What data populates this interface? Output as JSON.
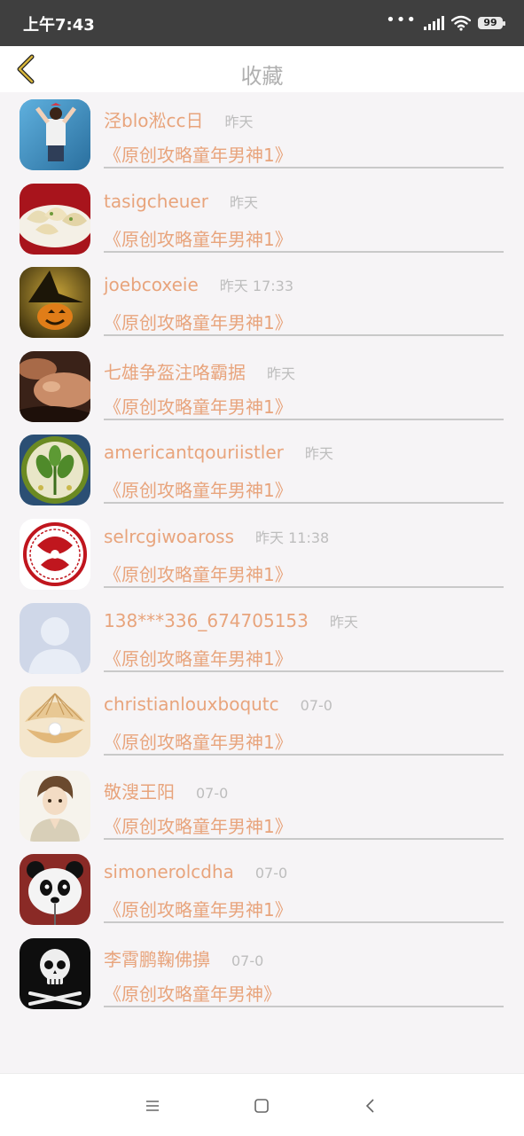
{
  "status_bar": {
    "time": "上午7:43",
    "dots": "•••",
    "battery": "99"
  },
  "header": {
    "title": "收藏",
    "back_icon": "chevron-left-icon"
  },
  "items": [
    {
      "name": "泾blo淞cc日",
      "time": "昨天",
      "title": "《原创攻略童年男神1》",
      "avatar": "photo-girl-wall"
    },
    {
      "name": "tasigcheuer",
      "time": "昨天",
      "title": "《原创攻略童年男神1》",
      "avatar": "photo-dumplings"
    },
    {
      "name": "joebcoxeie",
      "time": "昨天 17:33",
      "title": "《原创攻略童年男神1》",
      "avatar": "photo-halloween-pumpkin"
    },
    {
      "name": "七雄争盔注咯霸据",
      "time": "昨天",
      "title": "《原创攻略童年男神1》",
      "avatar": "photo-massage"
    },
    {
      "name": "americantqouriistler",
      "time": "昨天",
      "title": "《原创攻略童年男神1》",
      "avatar": "photo-leaf-plate"
    },
    {
      "name": "selrcgiwoaross",
      "time": "昨天 11:38",
      "title": "《原创攻略童年男神1》",
      "avatar": "photo-papercut"
    },
    {
      "name": "138***336_674705153",
      "time": "昨天",
      "title": "《原创攻略童年男神1》",
      "avatar": "default-avatar"
    },
    {
      "name": "christianlouxboqutc",
      "time": "07-0",
      "title": "《原创攻略童年男神1》",
      "avatar": "photo-shell-pearl"
    },
    {
      "name": "敬溲王阳",
      "time": "07-0",
      "title": "《原创攻略童年男神1》",
      "avatar": "anime-boy"
    },
    {
      "name": "simonerolcdha",
      "time": "07-0",
      "title": "《原创攻略童年男神1》",
      "avatar": "panda-cartoon"
    },
    {
      "name": "李霄鹏鞠佛擤",
      "time": "07-0",
      "title": "《原创攻略童年男神》",
      "avatar": "skull-crossbones"
    }
  ],
  "nav_bar": {
    "menu_icon": "menu-icon",
    "home_icon": "square-home-icon",
    "back_icon": "triangle-back-icon"
  },
  "colors": {
    "accent": "#e8a47c",
    "muted": "#bdbdbd",
    "divider": "#c9c9c9",
    "status_bg": "#3f3f3f",
    "back_chevron": "#c9a92a"
  }
}
